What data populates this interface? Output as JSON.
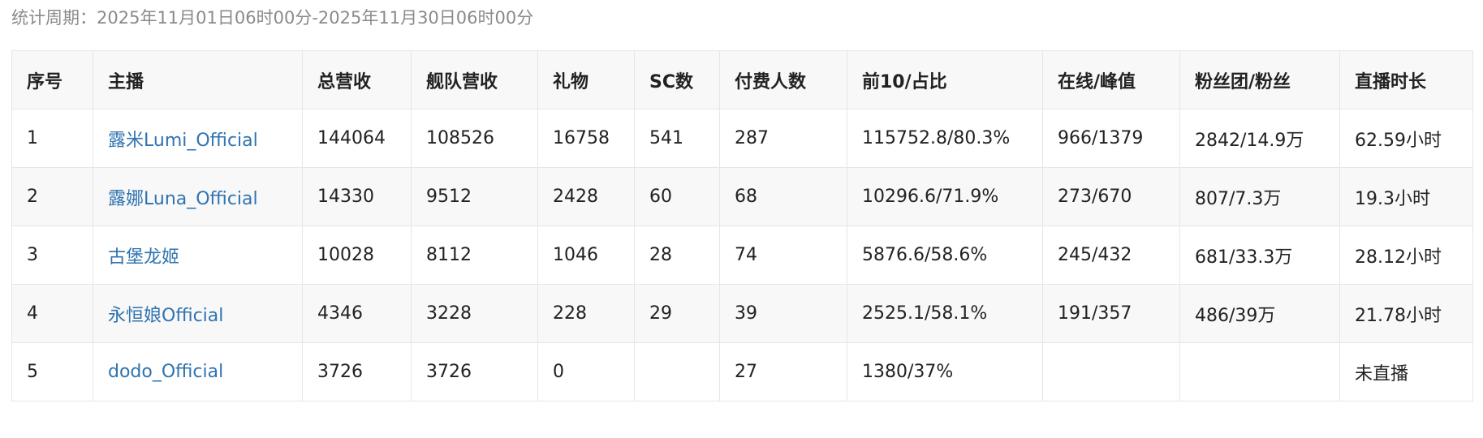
{
  "period_label": "统计周期：2025年11月01日06时00分-2025年11月30日06时00分",
  "link_color": "#2f73b0",
  "table": {
    "headers": [
      "序号",
      "主播",
      "总营收",
      "舰队营收",
      "礼物",
      "SC数",
      "付费人数",
      "前10/占比",
      "在线/峰值",
      "粉丝团/粉丝",
      "直播时长"
    ],
    "rows": [
      {
        "index": "1",
        "streamer": "露米Lumi_Official",
        "total_revenue": "144064",
        "fleet_revenue": "108526",
        "gifts": "16758",
        "sc_count": "541",
        "paying_users": "287",
        "top10_ratio": "115752.8/80.3%",
        "online_peak": "966/1379",
        "fanclub_fans": "2842/14.9万",
        "duration": "62.59小时"
      },
      {
        "index": "2",
        "streamer": "露娜Luna_Official",
        "total_revenue": "14330",
        "fleet_revenue": "9512",
        "gifts": "2428",
        "sc_count": "60",
        "paying_users": "68",
        "top10_ratio": "10296.6/71.9%",
        "online_peak": "273/670",
        "fanclub_fans": "807/7.3万",
        "duration": "19.3小时"
      },
      {
        "index": "3",
        "streamer": "古堡龙姬",
        "total_revenue": "10028",
        "fleet_revenue": "8112",
        "gifts": "1046",
        "sc_count": "28",
        "paying_users": "74",
        "top10_ratio": "5876.6/58.6%",
        "online_peak": "245/432",
        "fanclub_fans": "681/33.3万",
        "duration": "28.12小时"
      },
      {
        "index": "4",
        "streamer": "永恒娘Official",
        "total_revenue": "4346",
        "fleet_revenue": "3228",
        "gifts": "228",
        "sc_count": "29",
        "paying_users": "39",
        "top10_ratio": "2525.1/58.1%",
        "online_peak": "191/357",
        "fanclub_fans": "486/39万",
        "duration": "21.78小时"
      },
      {
        "index": "5",
        "streamer": "dodo_Official",
        "total_revenue": "3726",
        "fleet_revenue": "3726",
        "gifts": "0",
        "sc_count": "",
        "paying_users": "27",
        "top10_ratio": "1380/37%",
        "online_peak": "",
        "fanclub_fans": "",
        "duration": "未直播"
      }
    ]
  }
}
